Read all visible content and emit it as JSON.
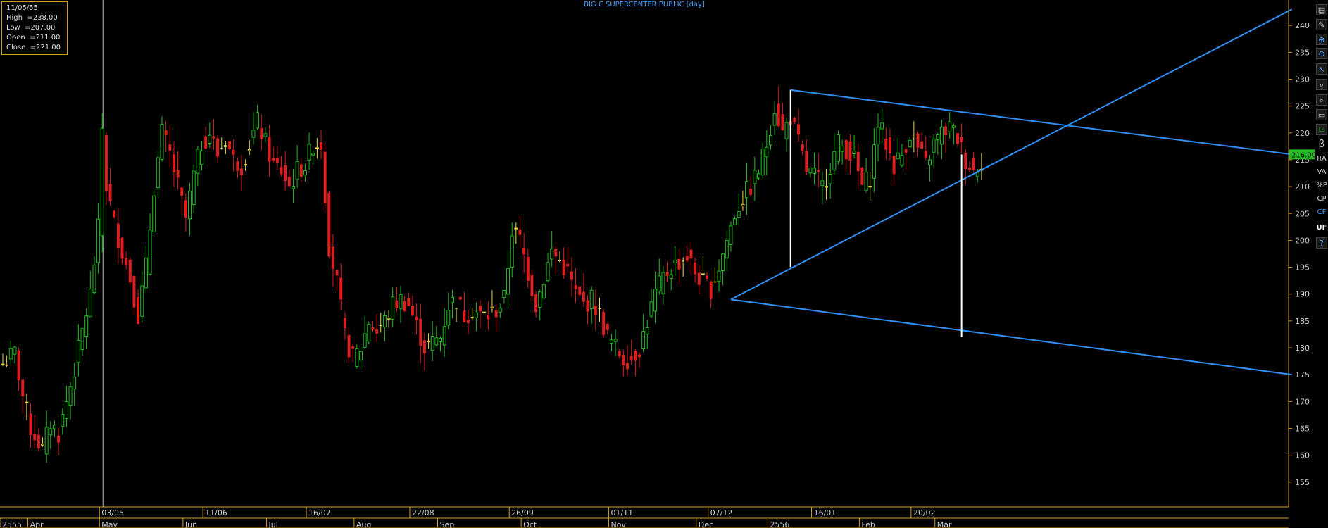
{
  "chart_data": {
    "type": "candlestick",
    "title": "BIG C SUPERCENTER PUBLIC [day]",
    "ylim": [
      150,
      245
    ],
    "y_ticks": [
      155,
      160,
      165,
      170,
      175,
      180,
      185,
      190,
      195,
      200,
      205,
      210,
      215,
      220,
      225,
      230,
      235,
      240
    ],
    "last_price_label": "216.00",
    "ohlc_readout": {
      "date": "11/05/55",
      "high_label": "High  =238.00",
      "low_label": "Low  =207.00",
      "open_label": "Open  =211.00",
      "close_label": "Close  =221.00"
    },
    "x_labels_top": [
      {
        "label": "03/05",
        "i": 25
      },
      {
        "label": "11/06",
        "i": 51
      },
      {
        "label": "16/07",
        "i": 77
      },
      {
        "label": "22/08",
        "i": 103
      },
      {
        "label": "26/09",
        "i": 128
      },
      {
        "label": "01/11",
        "i": 153
      },
      {
        "label": "07/12",
        "i": 178
      },
      {
        "label": "16/01",
        "i": 204
      },
      {
        "label": "20/02",
        "i": 229
      }
    ],
    "x_labels_bottom": [
      {
        "label": "2555",
        "i": 0
      },
      {
        "label": "Apr",
        "i": 7
      },
      {
        "label": "May",
        "i": 25
      },
      {
        "label": "Jun",
        "i": 46
      },
      {
        "label": "Jul",
        "i": 67
      },
      {
        "label": "Aug",
        "i": 89
      },
      {
        "label": "Sep",
        "i": 110
      },
      {
        "label": "Oct",
        "i": 131
      },
      {
        "label": "Nov",
        "i": 153
      },
      {
        "label": "Dec",
        "i": 175
      },
      {
        "label": "2556",
        "i": 193
      },
      {
        "label": "Feb",
        "i": 216
      },
      {
        "label": "Mar",
        "i": 235
      }
    ],
    "cursor_index": 25,
    "anchors": [
      {
        "i": 0,
        "p": 177
      },
      {
        "i": 3,
        "p": 179
      },
      {
        "i": 5,
        "p": 171
      },
      {
        "i": 7,
        "p": 165
      },
      {
        "i": 10,
        "p": 161
      },
      {
        "i": 12,
        "p": 166
      },
      {
        "i": 14,
        "p": 164
      },
      {
        "i": 16,
        "p": 170
      },
      {
        "i": 18,
        "p": 176
      },
      {
        "i": 20,
        "p": 183
      },
      {
        "i": 22,
        "p": 190
      },
      {
        "i": 24,
        "p": 202
      },
      {
        "i": 25,
        "p": 221
      },
      {
        "i": 26,
        "p": 210
      },
      {
        "i": 28,
        "p": 203
      },
      {
        "i": 30,
        "p": 198
      },
      {
        "i": 32,
        "p": 193
      },
      {
        "i": 34,
        "p": 186
      },
      {
        "i": 36,
        "p": 195
      },
      {
        "i": 38,
        "p": 210
      },
      {
        "i": 40,
        "p": 220
      },
      {
        "i": 42,
        "p": 216
      },
      {
        "i": 44,
        "p": 210
      },
      {
        "i": 46,
        "p": 204
      },
      {
        "i": 48,
        "p": 212
      },
      {
        "i": 50,
        "p": 218
      },
      {
        "i": 52,
        "p": 220
      },
      {
        "i": 54,
        "p": 216
      },
      {
        "i": 56,
        "p": 219
      },
      {
        "i": 58,
        "p": 215
      },
      {
        "i": 60,
        "p": 214
      },
      {
        "i": 62,
        "p": 218
      },
      {
        "i": 64,
        "p": 222
      },
      {
        "i": 66,
        "p": 218
      },
      {
        "i": 68,
        "p": 214
      },
      {
        "i": 70,
        "p": 213
      },
      {
        "i": 72,
        "p": 210
      },
      {
        "i": 74,
        "p": 213
      },
      {
        "i": 76,
        "p": 214
      },
      {
        "i": 78,
        "p": 218
      },
      {
        "i": 80,
        "p": 218
      },
      {
        "i": 82,
        "p": 199
      },
      {
        "i": 84,
        "p": 192
      },
      {
        "i": 86,
        "p": 182
      },
      {
        "i": 88,
        "p": 178
      },
      {
        "i": 90,
        "p": 180
      },
      {
        "i": 92,
        "p": 185
      },
      {
        "i": 94,
        "p": 183
      },
      {
        "i": 96,
        "p": 185
      },
      {
        "i": 98,
        "p": 188
      },
      {
        "i": 100,
        "p": 189
      },
      {
        "i": 102,
        "p": 188
      },
      {
        "i": 104,
        "p": 184
      },
      {
        "i": 106,
        "p": 180
      },
      {
        "i": 108,
        "p": 181
      },
      {
        "i": 110,
        "p": 182
      },
      {
        "i": 112,
        "p": 188
      },
      {
        "i": 114,
        "p": 189
      },
      {
        "i": 116,
        "p": 186
      },
      {
        "i": 118,
        "p": 187
      },
      {
        "i": 120,
        "p": 186
      },
      {
        "i": 122,
        "p": 186
      },
      {
        "i": 124,
        "p": 187
      },
      {
        "i": 126,
        "p": 189
      },
      {
        "i": 128,
        "p": 202
      },
      {
        "i": 130,
        "p": 200
      },
      {
        "i": 132,
        "p": 194
      },
      {
        "i": 134,
        "p": 188
      },
      {
        "i": 136,
        "p": 193
      },
      {
        "i": 138,
        "p": 198
      },
      {
        "i": 140,
        "p": 196
      },
      {
        "i": 142,
        "p": 194
      },
      {
        "i": 144,
        "p": 190
      },
      {
        "i": 146,
        "p": 188
      },
      {
        "i": 148,
        "p": 189
      },
      {
        "i": 150,
        "p": 186
      },
      {
        "i": 152,
        "p": 182
      },
      {
        "i": 154,
        "p": 180
      },
      {
        "i": 156,
        "p": 178
      },
      {
        "i": 158,
        "p": 178
      },
      {
        "i": 160,
        "p": 180
      },
      {
        "i": 162,
        "p": 185
      },
      {
        "i": 164,
        "p": 190
      },
      {
        "i": 166,
        "p": 193
      },
      {
        "i": 168,
        "p": 195
      },
      {
        "i": 170,
        "p": 196
      },
      {
        "i": 172,
        "p": 197
      },
      {
        "i": 174,
        "p": 194
      },
      {
        "i": 176,
        "p": 192
      },
      {
        "i": 178,
        "p": 191
      },
      {
        "i": 180,
        "p": 195
      },
      {
        "i": 182,
        "p": 200
      },
      {
        "i": 184,
        "p": 205
      },
      {
        "i": 186,
        "p": 208
      },
      {
        "i": 188,
        "p": 210
      },
      {
        "i": 190,
        "p": 213
      },
      {
        "i": 192,
        "p": 218
      },
      {
        "i": 194,
        "p": 225
      },
      {
        "i": 196,
        "p": 220
      },
      {
        "i": 198,
        "p": 223
      },
      {
        "i": 200,
        "p": 218
      },
      {
        "i": 202,
        "p": 213
      },
      {
        "i": 204,
        "p": 212
      },
      {
        "i": 206,
        "p": 210
      },
      {
        "i": 208,
        "p": 214
      },
      {
        "i": 210,
        "p": 218
      },
      {
        "i": 212,
        "p": 217
      },
      {
        "i": 214,
        "p": 215
      },
      {
        "i": 216,
        "p": 210
      },
      {
        "i": 218,
        "p": 212
      },
      {
        "i": 220,
        "p": 222
      },
      {
        "i": 222,
        "p": 218
      },
      {
        "i": 224,
        "p": 214
      },
      {
        "i": 226,
        "p": 216
      },
      {
        "i": 228,
        "p": 220
      },
      {
        "i": 230,
        "p": 217
      },
      {
        "i": 232,
        "p": 214
      },
      {
        "i": 234,
        "p": 218
      },
      {
        "i": 236,
        "p": 220
      },
      {
        "i": 238,
        "p": 221
      },
      {
        "i": 240,
        "p": 219
      },
      {
        "i": 242,
        "p": 215
      },
      {
        "i": 244,
        "p": 213
      },
      {
        "i": 246,
        "p": 215
      }
    ],
    "trend_lines": [
      {
        "from": {
          "i": 198,
          "p": 228
        },
        "to": {
          "i": 324,
          "p": 216
        },
        "color": "#2f8ff5"
      },
      {
        "from": {
          "i": 183,
          "p": 189
        },
        "to": {
          "i": 324,
          "p": 175
        },
        "color": "#2f8ff5"
      },
      {
        "from": {
          "i": 183,
          "p": 189
        },
        "to": {
          "i": 324,
          "p": 243
        },
        "color": "#2f8ff5"
      },
      {
        "from": {
          "i": 198,
          "p": 228
        },
        "to": {
          "i": 198,
          "p": 195
        },
        "color": "#ffffff"
      },
      {
        "from": {
          "i": 241,
          "p": 216
        },
        "to": {
          "i": 241,
          "p": 182
        },
        "color": "#ffffff"
      }
    ]
  },
  "toolbar": {
    "beta": "β",
    "ra": "RA",
    "va": "VA",
    "pp": "%P",
    "cp": "CP",
    "cf": "CF",
    "uf": "UF",
    "help": "?",
    "ls": "Ls"
  },
  "colors": {
    "up": "#1fbf1f",
    "down": "#e01c1c",
    "doji": "#e8d84a",
    "grid": "#d4a017",
    "axis_text": "#cccccc",
    "title": "#4aa3ff"
  }
}
